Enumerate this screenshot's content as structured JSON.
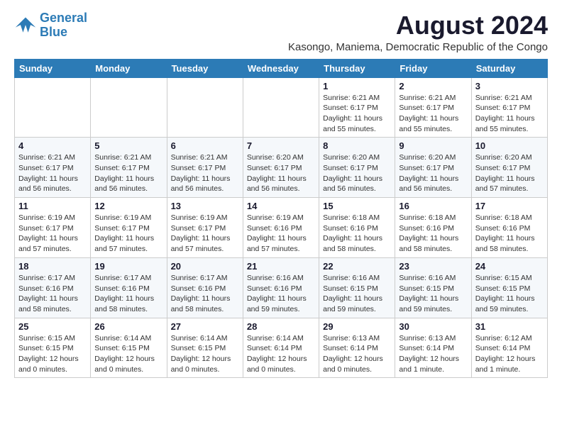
{
  "logo": {
    "line1": "General",
    "line2": "Blue"
  },
  "title": "August 2024",
  "location": "Kasongo, Maniema, Democratic Republic of the Congo",
  "days_of_week": [
    "Sunday",
    "Monday",
    "Tuesday",
    "Wednesday",
    "Thursday",
    "Friday",
    "Saturday"
  ],
  "weeks": [
    [
      {
        "day": "",
        "info": ""
      },
      {
        "day": "",
        "info": ""
      },
      {
        "day": "",
        "info": ""
      },
      {
        "day": "",
        "info": ""
      },
      {
        "day": "1",
        "info": "Sunrise: 6:21 AM\nSunset: 6:17 PM\nDaylight: 11 hours\nand 55 minutes."
      },
      {
        "day": "2",
        "info": "Sunrise: 6:21 AM\nSunset: 6:17 PM\nDaylight: 11 hours\nand 55 minutes."
      },
      {
        "day": "3",
        "info": "Sunrise: 6:21 AM\nSunset: 6:17 PM\nDaylight: 11 hours\nand 55 minutes."
      }
    ],
    [
      {
        "day": "4",
        "info": "Sunrise: 6:21 AM\nSunset: 6:17 PM\nDaylight: 11 hours\nand 56 minutes."
      },
      {
        "day": "5",
        "info": "Sunrise: 6:21 AM\nSunset: 6:17 PM\nDaylight: 11 hours\nand 56 minutes."
      },
      {
        "day": "6",
        "info": "Sunrise: 6:21 AM\nSunset: 6:17 PM\nDaylight: 11 hours\nand 56 minutes."
      },
      {
        "day": "7",
        "info": "Sunrise: 6:20 AM\nSunset: 6:17 PM\nDaylight: 11 hours\nand 56 minutes."
      },
      {
        "day": "8",
        "info": "Sunrise: 6:20 AM\nSunset: 6:17 PM\nDaylight: 11 hours\nand 56 minutes."
      },
      {
        "day": "9",
        "info": "Sunrise: 6:20 AM\nSunset: 6:17 PM\nDaylight: 11 hours\nand 56 minutes."
      },
      {
        "day": "10",
        "info": "Sunrise: 6:20 AM\nSunset: 6:17 PM\nDaylight: 11 hours\nand 57 minutes."
      }
    ],
    [
      {
        "day": "11",
        "info": "Sunrise: 6:19 AM\nSunset: 6:17 PM\nDaylight: 11 hours\nand 57 minutes."
      },
      {
        "day": "12",
        "info": "Sunrise: 6:19 AM\nSunset: 6:17 PM\nDaylight: 11 hours\nand 57 minutes."
      },
      {
        "day": "13",
        "info": "Sunrise: 6:19 AM\nSunset: 6:17 PM\nDaylight: 11 hours\nand 57 minutes."
      },
      {
        "day": "14",
        "info": "Sunrise: 6:19 AM\nSunset: 6:16 PM\nDaylight: 11 hours\nand 57 minutes."
      },
      {
        "day": "15",
        "info": "Sunrise: 6:18 AM\nSunset: 6:16 PM\nDaylight: 11 hours\nand 58 minutes."
      },
      {
        "day": "16",
        "info": "Sunrise: 6:18 AM\nSunset: 6:16 PM\nDaylight: 11 hours\nand 58 minutes."
      },
      {
        "day": "17",
        "info": "Sunrise: 6:18 AM\nSunset: 6:16 PM\nDaylight: 11 hours\nand 58 minutes."
      }
    ],
    [
      {
        "day": "18",
        "info": "Sunrise: 6:17 AM\nSunset: 6:16 PM\nDaylight: 11 hours\nand 58 minutes."
      },
      {
        "day": "19",
        "info": "Sunrise: 6:17 AM\nSunset: 6:16 PM\nDaylight: 11 hours\nand 58 minutes."
      },
      {
        "day": "20",
        "info": "Sunrise: 6:17 AM\nSunset: 6:16 PM\nDaylight: 11 hours\nand 58 minutes."
      },
      {
        "day": "21",
        "info": "Sunrise: 6:16 AM\nSunset: 6:16 PM\nDaylight: 11 hours\nand 59 minutes."
      },
      {
        "day": "22",
        "info": "Sunrise: 6:16 AM\nSunset: 6:15 PM\nDaylight: 11 hours\nand 59 minutes."
      },
      {
        "day": "23",
        "info": "Sunrise: 6:16 AM\nSunset: 6:15 PM\nDaylight: 11 hours\nand 59 minutes."
      },
      {
        "day": "24",
        "info": "Sunrise: 6:15 AM\nSunset: 6:15 PM\nDaylight: 11 hours\nand 59 minutes."
      }
    ],
    [
      {
        "day": "25",
        "info": "Sunrise: 6:15 AM\nSunset: 6:15 PM\nDaylight: 12 hours\nand 0 minutes."
      },
      {
        "day": "26",
        "info": "Sunrise: 6:14 AM\nSunset: 6:15 PM\nDaylight: 12 hours\nand 0 minutes."
      },
      {
        "day": "27",
        "info": "Sunrise: 6:14 AM\nSunset: 6:15 PM\nDaylight: 12 hours\nand 0 minutes."
      },
      {
        "day": "28",
        "info": "Sunrise: 6:14 AM\nSunset: 6:14 PM\nDaylight: 12 hours\nand 0 minutes."
      },
      {
        "day": "29",
        "info": "Sunrise: 6:13 AM\nSunset: 6:14 PM\nDaylight: 12 hours\nand 0 minutes."
      },
      {
        "day": "30",
        "info": "Sunrise: 6:13 AM\nSunset: 6:14 PM\nDaylight: 12 hours\nand 1 minute."
      },
      {
        "day": "31",
        "info": "Sunrise: 6:12 AM\nSunset: 6:14 PM\nDaylight: 12 hours\nand 1 minute."
      }
    ]
  ]
}
